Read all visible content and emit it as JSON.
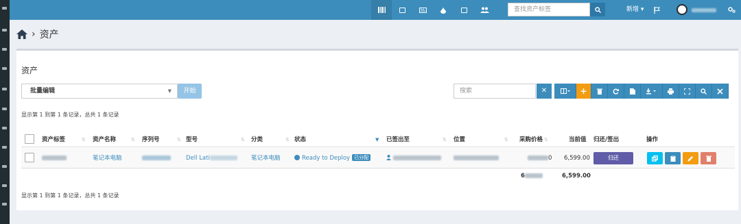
{
  "topbar": {
    "search_placeholder": "查找资产标签",
    "new_label": "新增",
    "new_caret": "▾",
    "username_redacted": true
  },
  "breadcrumb": {
    "separator": "›",
    "current": "资产"
  },
  "box": {
    "title": "资产",
    "bulk_select_value": "批量编辑",
    "bulk_caret": "▼",
    "go_button": "开始",
    "table_search_placeholder": "搜索",
    "clear_button": "✕",
    "toolbar_plus": "+"
  },
  "pagination": {
    "top_text": "显示第 1 到第 1 条记录，总共 1 条记录",
    "bottom_text": "显示第 1 到第 1 条记录，总共 1 条记录"
  },
  "table": {
    "headers": {
      "asset_tag": "资产标签",
      "asset_name": "资产名称",
      "serial": "序列号",
      "model": "型号",
      "category": "分类",
      "status": "状态",
      "checked_out_to": "已签出至",
      "location": "位置",
      "purchase_cost": "采购价格",
      "current_value": "当前值",
      "checkin_checkout": "归还/签出",
      "actions": "操作"
    },
    "rows": [
      {
        "asset_name": "笔记本电脑",
        "model_prefix": "Dell Lati",
        "category": "笔记本电脑",
        "status": "Ready to Deploy",
        "status_badge": "已分配",
        "purchase_cost_suffix": "0",
        "current_value": "6,599.00",
        "checkin_button": "归还"
      }
    ],
    "footer": {
      "purchase_cost_prefix": "6",
      "current_value_total": "6,599.00"
    }
  },
  "colors": {
    "topbar": "#3c8dbc",
    "checkin_button": "#605ca8",
    "action_clone": "#00c0ef",
    "action_audit": "#3c8dbc",
    "action_edit": "#f39c12",
    "action_delete": "#e0806c"
  }
}
